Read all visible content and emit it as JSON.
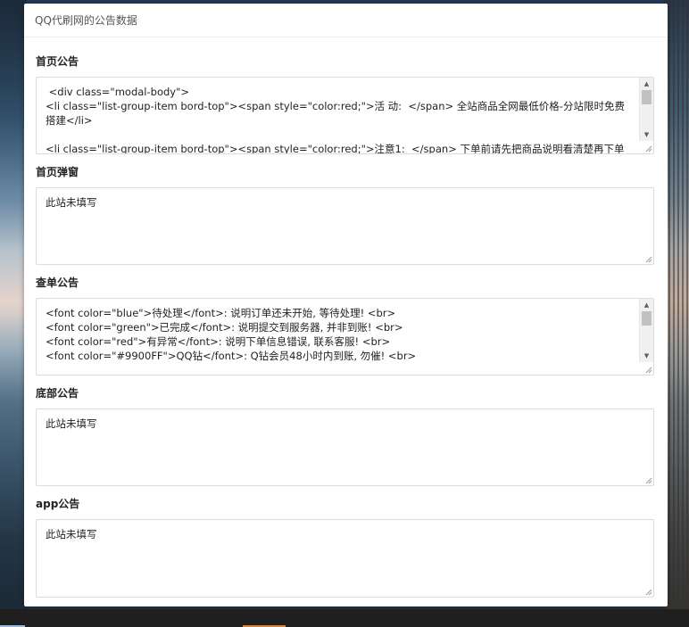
{
  "modal": {
    "title": "QQ代刷网的公告数据"
  },
  "fields": [
    {
      "label": "首页公告",
      "value": " <div class=\"modal-body\">\n<li class=\"list-group-item bord-top\"><span style=\"color:red;\">活 动:  </span> 全站商品全网最低价格-分站限时免费搭建</li>\n\n<li class=\"list-group-item bord-top\"><span style=\"color:red;\">注意1:  </span> 下单前请先把商品说明看清楚再下单"
    },
    {
      "label": "首页弹窗",
      "value": "此站未填写"
    },
    {
      "label": "查单公告",
      "value": "<font color=\"blue\">待处理</font>: 说明订单还未开始, 等待处理! <br>\n<font color=\"green\">已完成</font>: 说明提交到服务器, 并非到账! <br>\n<font color=\"red\">有异常</font>: 说明下单信息错误, 联系客服! <br>\n<font color=\"#9900FF\">QQ钻</font>: Q钻会员48小时内到账, 勿催! <br>"
    },
    {
      "label": "底部公告",
      "value": "此站未填写"
    },
    {
      "label": "app公告",
      "value": "此站未填写"
    }
  ]
}
